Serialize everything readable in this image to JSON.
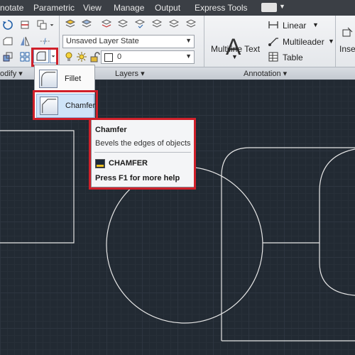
{
  "menubar": {
    "items": [
      "notate",
      "Parametric",
      "View",
      "Manage",
      "Output",
      "Express Tools"
    ],
    "extra_arrow": "▼"
  },
  "ribbon": {
    "layer_state": "Unsaved Layer State",
    "layer_name": "0",
    "dimension_type": "Linear",
    "multileader_label": "Multileader",
    "table_label": "Table",
    "multiline_text_label": "Multiline Text",
    "insert_partial": "Inse",
    "panels": {
      "modify": "odify ▾",
      "layers": "Layers ▾",
      "annotation": "Annotation ▾"
    }
  },
  "dropdown": {
    "items": [
      {
        "label": "Fillet",
        "icon": "fillet-icon"
      },
      {
        "label": "Chamfer",
        "icon": "chamfer-icon"
      }
    ]
  },
  "tooltip": {
    "title": "Chamfer",
    "description": "Bevels the edges of objects",
    "command": "CHAMFER",
    "help": "Press F1 for more help"
  },
  "colors": {
    "highlight": "#d0202a",
    "canvas_bg": "#222a33",
    "geometry": "#e6e6e6"
  }
}
